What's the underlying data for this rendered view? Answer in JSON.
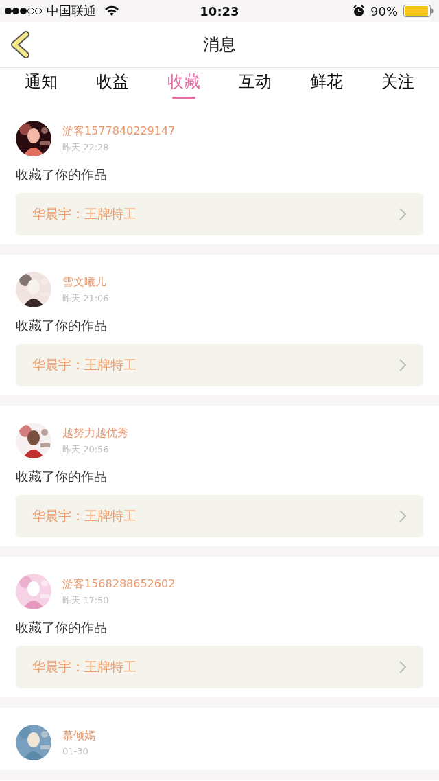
{
  "status_bar": {
    "carrier": "中国联通",
    "time": "10:23",
    "battery": "90%"
  },
  "nav": {
    "title": "消息"
  },
  "tabs": [
    {
      "label": "通知",
      "selected": false
    },
    {
      "label": "收益",
      "selected": false
    },
    {
      "label": "收藏",
      "selected": true
    },
    {
      "label": "互动",
      "selected": false
    },
    {
      "label": "鲜花",
      "selected": false
    },
    {
      "label": "关注",
      "selected": false
    }
  ],
  "messages": [
    {
      "user": "游客1577840229147",
      "time": "昨天 22:28",
      "text": "收藏了你的作品",
      "work": "华晨宇：王牌特工"
    },
    {
      "user": "雪文曦儿",
      "time": "昨天 21:06",
      "text": "收藏了你的作品",
      "work": "华晨宇：王牌特工"
    },
    {
      "user": "越努力越优秀",
      "time": "昨天 20:56",
      "text": "收藏了你的作品",
      "work": "华晨宇：王牌特工"
    },
    {
      "user": "游客1568288652602",
      "time": "昨天 17:50",
      "text": "收藏了你的作品",
      "work": "华晨宇：王牌特工"
    },
    {
      "user": "慕倾嫣",
      "time": "01-30"
    }
  ]
}
